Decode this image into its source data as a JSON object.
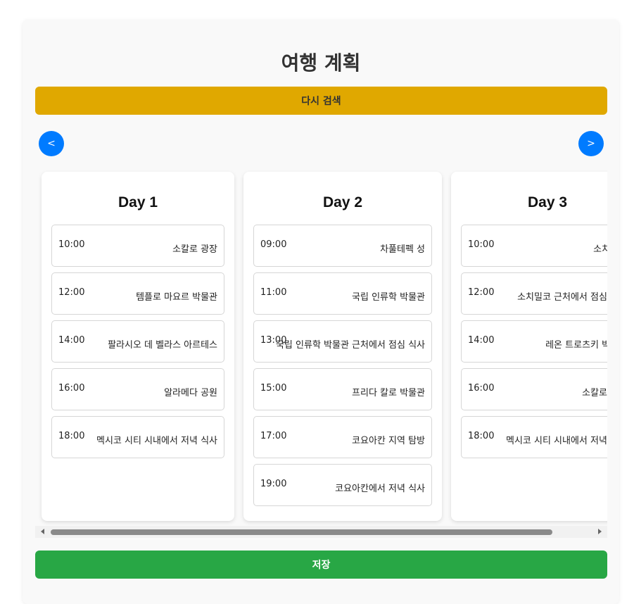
{
  "header": {
    "title": "여행 계획"
  },
  "toolbar": {
    "research_label": "다시 검색",
    "save_label": "저장"
  },
  "nav": {
    "prev_label": "<",
    "next_label": ">"
  },
  "days": [
    {
      "title": "Day 1",
      "activities": [
        {
          "time": "10:00",
          "place": "소칼로 광장"
        },
        {
          "time": "12:00",
          "place": "템플로 마요르 박물관"
        },
        {
          "time": "14:00",
          "place": "팔라시오 데 벨라스 아르테스"
        },
        {
          "time": "16:00",
          "place": "알라메다 공원"
        },
        {
          "time": "18:00",
          "place": "멕시코 시티 시내에서 저녁 식사"
        }
      ]
    },
    {
      "title": "Day 2",
      "activities": [
        {
          "time": "09:00",
          "place": "차풀테펙 성"
        },
        {
          "time": "11:00",
          "place": "국립 인류학 박물관"
        },
        {
          "time": "13:00",
          "place": "국립 인류학 박물관 근처에서 점심 식사"
        },
        {
          "time": "15:00",
          "place": "프리다 칼로 박물관"
        },
        {
          "time": "17:00",
          "place": "코요아칸 지역 탐방"
        },
        {
          "time": "19:00",
          "place": "코요아칸에서 저녁 식사"
        }
      ]
    },
    {
      "title": "Day 3",
      "activities": [
        {
          "time": "10:00",
          "place": "소치밀코"
        },
        {
          "time": "12:00",
          "place": "소치밀코 근처에서 점심 식사"
        },
        {
          "time": "14:00",
          "place": "레온 트로츠키 박물관"
        },
        {
          "time": "16:00",
          "place": "소칼로 광장"
        },
        {
          "time": "18:00",
          "place": "멕시코 시티 시내에서 저녁 식사"
        }
      ]
    }
  ],
  "colors": {
    "research_button": "#e0a800",
    "nav_button": "#007bff",
    "save_button": "#28a745"
  }
}
